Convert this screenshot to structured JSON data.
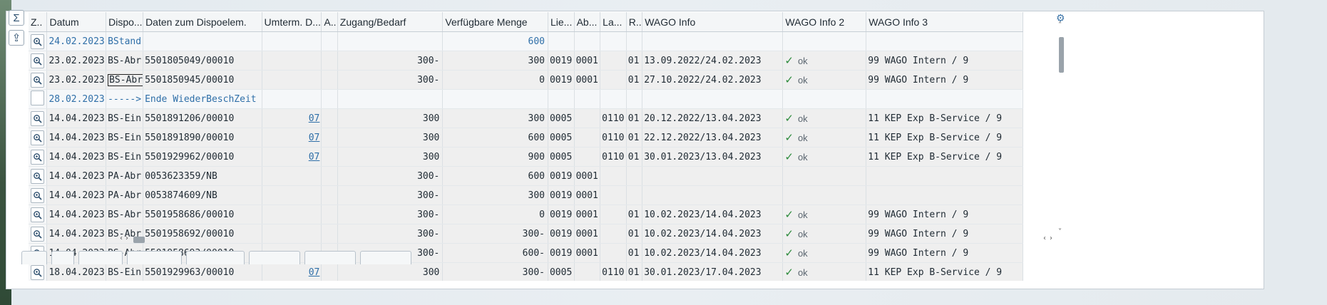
{
  "side_buttons": [
    {
      "name": "sum-icon",
      "glyph": "Σ"
    },
    {
      "name": "export-icon",
      "glyph": "⇪"
    }
  ],
  "columns": [
    "Z..",
    "Datum",
    "Dispo...",
    "Daten zum Dispoelem.",
    "Umterm. D...",
    "A..",
    "Zugang/Bedarf",
    "Verfügbare Menge",
    "Lie...",
    "Ab...",
    "La...",
    "R..",
    "WAGO Info",
    "WAGO Info 2",
    "WAGO Info 3"
  ],
  "rows": [
    {
      "style": "blue",
      "view": "button",
      "datum": "24.02.2023",
      "dispo": "BStand",
      "daten": "",
      "umterm": "",
      "zugang": "",
      "verfuegbar": "600",
      "lie": "",
      "ab": "",
      "la": "",
      "r": "",
      "wago1": "",
      "ok": false,
      "wago2": "",
      "wago3": ""
    },
    {
      "style": "",
      "view": "button",
      "datum": "23.02.2023",
      "dispo": "BS-Abr",
      "daten": "5501805049/00010",
      "umterm": "",
      "zugang": "300-",
      "verfuegbar": "300",
      "lie": "0019",
      "ab": "0001",
      "la": "",
      "r": "01",
      "wago1": "13.09.2022/24.02.2023",
      "ok": true,
      "wago2": "ok",
      "wago3": "99 WAGO Intern / 9"
    },
    {
      "style": "",
      "view": "button",
      "datum": "23.02.2023",
      "dispo": "BS-Abr",
      "selected": true,
      "daten": "5501850945/00010",
      "umterm": "",
      "zugang": "300-",
      "verfuegbar": "0",
      "lie": "0019",
      "ab": "0001",
      "la": "",
      "r": "01",
      "wago1": "27.10.2022/24.02.2023",
      "ok": true,
      "wago2": "ok",
      "wago3": "99 WAGO Intern / 9"
    },
    {
      "style": "blue",
      "view": "empty",
      "datum": "28.02.2023",
      "dispo": "----->",
      "daten": "Ende WiederBeschZeit",
      "umterm": "",
      "zugang": "",
      "verfuegbar": "",
      "lie": "",
      "ab": "",
      "la": "",
      "r": "",
      "wago1": "",
      "ok": false,
      "wago2": "",
      "wago3": ""
    },
    {
      "style": "",
      "view": "button",
      "datum": "14.04.2023",
      "dispo": "BS-Ein",
      "daten": "5501891206/00010",
      "umterm": "07",
      "zugang": "300",
      "verfuegbar": "300",
      "lie": "0005",
      "ab": "",
      "la": "0110",
      "r": "01",
      "wago1": "20.12.2022/13.04.2023",
      "ok": true,
      "wago2": "ok",
      "wago3": "11 KEP Exp B-Service / 9"
    },
    {
      "style": "",
      "view": "button",
      "datum": "14.04.2023",
      "dispo": "BS-Ein",
      "daten": "5501891890/00010",
      "umterm": "07",
      "zugang": "300",
      "verfuegbar": "600",
      "lie": "0005",
      "ab": "",
      "la": "0110",
      "r": "01",
      "wago1": "22.12.2022/13.04.2023",
      "ok": true,
      "wago2": "ok",
      "wago3": "11 KEP Exp B-Service / 9"
    },
    {
      "style": "",
      "view": "button",
      "datum": "14.04.2023",
      "dispo": "BS-Ein",
      "daten": "5501929962/00010",
      "umterm": "07",
      "zugang": "300",
      "verfuegbar": "900",
      "lie": "0005",
      "ab": "",
      "la": "0110",
      "r": "01",
      "wago1": "30.01.2023/13.04.2023",
      "ok": true,
      "wago2": "ok",
      "wago3": "11 KEP Exp B-Service / 9"
    },
    {
      "style": "",
      "view": "button",
      "datum": "14.04.2023",
      "dispo": "PA-Abr",
      "daten": "0053623359/NB",
      "umterm": "",
      "zugang": "300-",
      "verfuegbar": "600",
      "lie": "0019",
      "ab": "0001",
      "la": "",
      "r": "",
      "wago1": "",
      "ok": false,
      "wago2": "",
      "wago3": ""
    },
    {
      "style": "",
      "view": "button",
      "datum": "14.04.2023",
      "dispo": "PA-Abr",
      "daten": "0053874609/NB",
      "umterm": "",
      "zugang": "300-",
      "verfuegbar": "300",
      "lie": "0019",
      "ab": "0001",
      "la": "",
      "r": "",
      "wago1": "",
      "ok": false,
      "wago2": "",
      "wago3": ""
    },
    {
      "style": "",
      "view": "button",
      "datum": "14.04.2023",
      "dispo": "BS-Abr",
      "daten": "5501958686/00010",
      "umterm": "",
      "zugang": "300-",
      "verfuegbar": "0",
      "lie": "0019",
      "ab": "0001",
      "la": "",
      "r": "01",
      "wago1": "10.02.2023/14.04.2023",
      "ok": true,
      "wago2": "ok",
      "wago3": "99 WAGO Intern / 9"
    },
    {
      "style": "",
      "view": "button",
      "datum": "14.04.2023",
      "dispo": "BS-Abr",
      "daten": "5501958692/00010",
      "umterm": "",
      "zugang": "300-",
      "verfuegbar": "300-",
      "lie": "0019",
      "ab": "0001",
      "la": "",
      "r": "01",
      "wago1": "10.02.2023/14.04.2023",
      "ok": true,
      "wago2": "ok",
      "wago3": "99 WAGO Intern / 9"
    },
    {
      "style": "",
      "view": "button",
      "datum": "14.04.2023",
      "dispo": "BS-Abr",
      "daten": "5501958693/00010",
      "umterm": "",
      "zugang": "300-",
      "verfuegbar": "600-",
      "lie": "0019",
      "ab": "0001",
      "la": "",
      "r": "01",
      "wago1": "10.02.2023/14.04.2023",
      "ok": true,
      "wago2": "ok",
      "wago3": "99 WAGO Intern / 9"
    },
    {
      "style": "",
      "view": "button",
      "datum": "18.04.2023",
      "dispo": "BS-Ein",
      "daten": "5501929963/00010",
      "umterm": "07",
      "zugang": "300",
      "verfuegbar": "300-",
      "lie": "0005",
      "ab": "",
      "la": "0110",
      "r": "01",
      "wago1": "30.01.2023/17.04.2023",
      "ok": true,
      "wago2": "ok",
      "wago3": "11 KEP Exp B-Service / 9"
    }
  ],
  "colors": {
    "link": "#2f6fa8",
    "check": "#2e8b3d"
  },
  "icons": {
    "view": "magnifier-icon",
    "settings": "gear-icon"
  }
}
